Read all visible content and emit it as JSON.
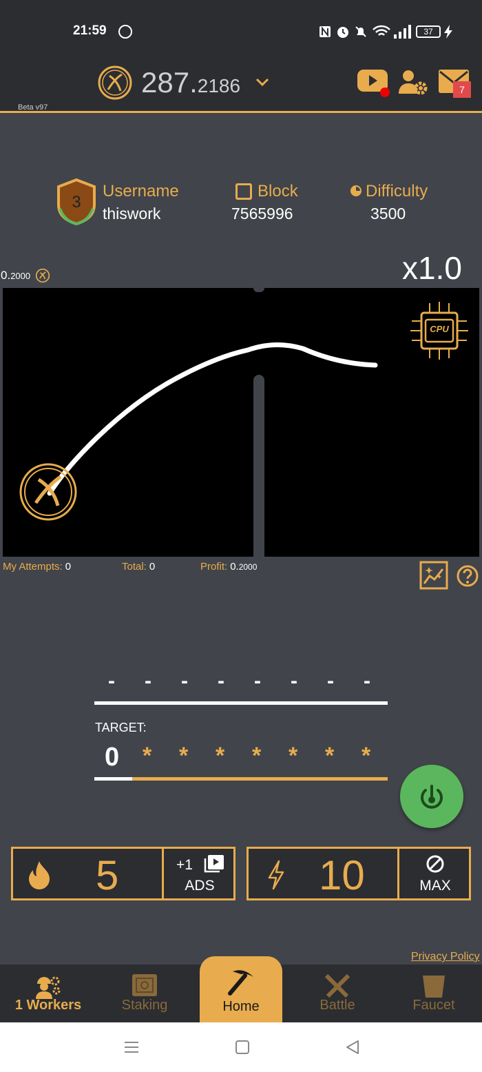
{
  "status_bar": {
    "time": "21:59",
    "battery": "37",
    "icons": [
      "whatsapp-icon",
      "nfc-icon",
      "alarm-icon",
      "mute-icon",
      "wifi-icon",
      "signal-icon",
      "battery-icon",
      "charging-icon"
    ]
  },
  "header": {
    "balance_int": "287.",
    "balance_dec": "2186",
    "beta_label": "Beta v97",
    "mail_count": "7"
  },
  "stats": {
    "level": "3",
    "username_label": "Username",
    "username": "thiswork",
    "block_label": "Block",
    "block": "7565996",
    "difficulty_label": "Difficulty",
    "difficulty": "3500"
  },
  "game": {
    "min_bet_int": "0.",
    "min_bet_dec": "2000",
    "multiplier": "x1.0",
    "cpu_label": "CPU"
  },
  "attempts": {
    "my_attempts_label": "My Attempts:",
    "my_attempts": "0",
    "total_label": "Total:",
    "total": "0",
    "profit_label": "Profit:",
    "profit_int": "0.",
    "profit_dec": "2000"
  },
  "code": {
    "dashes": [
      "-",
      "-",
      "-",
      "-",
      "-",
      "-",
      "-",
      "-"
    ],
    "target_label": "TARGET:",
    "target_first": "0",
    "target_stars": [
      "*",
      "*",
      "*",
      "*",
      "*",
      "*",
      "*"
    ],
    "progress": 0.13
  },
  "boosts": {
    "fire_value": "5",
    "ads_top": "+1",
    "ads_label": "ADS",
    "energy_value": "10",
    "max_label": "MAX"
  },
  "links": {
    "privacy": "Privacy Policy"
  },
  "nav": {
    "workers": "1 Workers",
    "staking": "Staking",
    "home": "Home",
    "battle": "Battle",
    "faucet": "Faucet"
  },
  "colors": {
    "accent": "#e8ac4e",
    "bg": "#41444a",
    "bar": "#2b2d31",
    "power": "#5bb75d"
  }
}
